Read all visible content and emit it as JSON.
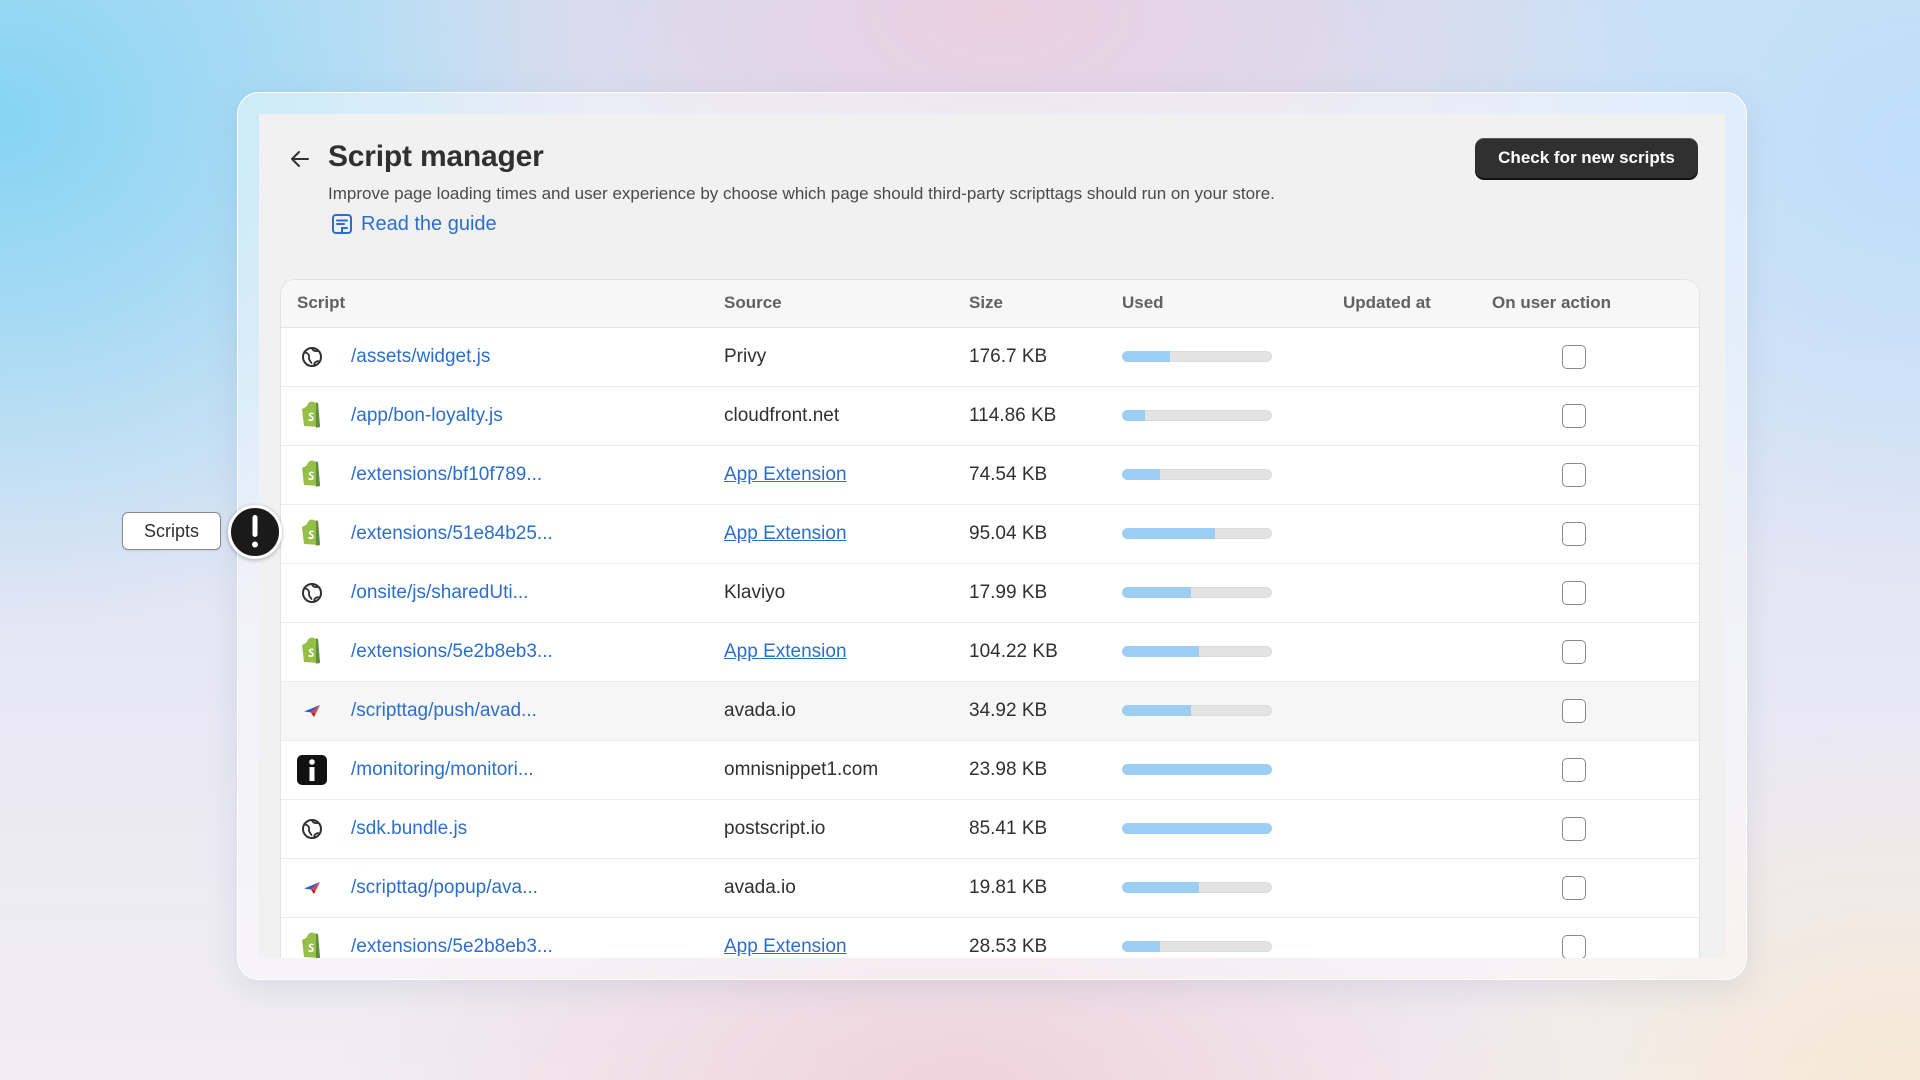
{
  "header": {
    "title": "Script manager",
    "subtitle": "Improve page loading times and user experience by choose which page should third-party scripttags should run on your store.",
    "guide_link": "Read the guide",
    "check_button": "Check for new scripts"
  },
  "table": {
    "columns": [
      "Script",
      "Source",
      "Size",
      "Used",
      "Updated at",
      "On user action"
    ],
    "rows": [
      {
        "icon": "globe-icon",
        "script": "/assets/widget.js",
        "source": "Privy",
        "source_is_link": false,
        "size": "176.7 KB",
        "used": 0.32,
        "updated_at": "",
        "on_user_action": false
      },
      {
        "icon": "shopify-icon",
        "script": "/app/bon-loyalty.js",
        "source": "cloudfront.net",
        "source_is_link": false,
        "size": "114.86 KB",
        "used": 0.15,
        "updated_at": "",
        "on_user_action": false
      },
      {
        "icon": "shopify-icon",
        "script": "/extensions/bf10f789...",
        "source": "App Extension",
        "source_is_link": true,
        "size": "74.54 KB",
        "used": 0.25,
        "updated_at": "",
        "on_user_action": false
      },
      {
        "icon": "shopify-icon",
        "script": "/extensions/51e84b25...",
        "source": "App Extension",
        "source_is_link": true,
        "size": "95.04 KB",
        "used": 0.62,
        "updated_at": "",
        "on_user_action": false
      },
      {
        "icon": "globe-icon",
        "script": "/onsite/js/sharedUti...",
        "source": "Klaviyo",
        "source_is_link": false,
        "size": "17.99 KB",
        "used": 0.46,
        "updated_at": "",
        "on_user_action": false
      },
      {
        "icon": "shopify-icon",
        "script": "/extensions/5e2b8eb3...",
        "source": "App Extension",
        "source_is_link": true,
        "size": "104.22 KB",
        "used": 0.51,
        "updated_at": "",
        "on_user_action": false
      },
      {
        "icon": "avada-icon",
        "script": "/scripttag/push/avad...",
        "source": "avada.io",
        "source_is_link": false,
        "size": "34.92 KB",
        "used": 0.46,
        "updated_at": "",
        "on_user_action": false
      },
      {
        "icon": "omnisend-icon",
        "script": "/monitoring/monitori...",
        "source": "omnisnippet1.com",
        "source_is_link": false,
        "size": "23.98 KB",
        "used": 1.0,
        "updated_at": "",
        "on_user_action": false
      },
      {
        "icon": "globe-icon",
        "script": "/sdk.bundle.js",
        "source": "postscript.io",
        "source_is_link": false,
        "size": "85.41 KB",
        "used": 1.0,
        "updated_at": "",
        "on_user_action": false
      },
      {
        "icon": "avada-icon",
        "script": "/scripttag/popup/ava...",
        "source": "avada.io",
        "source_is_link": false,
        "size": "19.81 KB",
        "used": 0.51,
        "updated_at": "",
        "on_user_action": false
      },
      {
        "icon": "shopify-icon",
        "script": "/extensions/5e2b8eb3...",
        "source": "App Extension",
        "source_is_link": true,
        "size": "28.53 KB",
        "used": 0.25,
        "updated_at": "",
        "on_user_action": false
      }
    ]
  },
  "annotation": {
    "label": "Scripts",
    "badge_icon": "exclamation-icon"
  },
  "colors": {
    "link": "#2c6ecb",
    "bar_fill": "#9ccdf2",
    "bar_track": "#e3e3e3",
    "button_bg": "#303030",
    "shopify_green": "#95bf47"
  }
}
